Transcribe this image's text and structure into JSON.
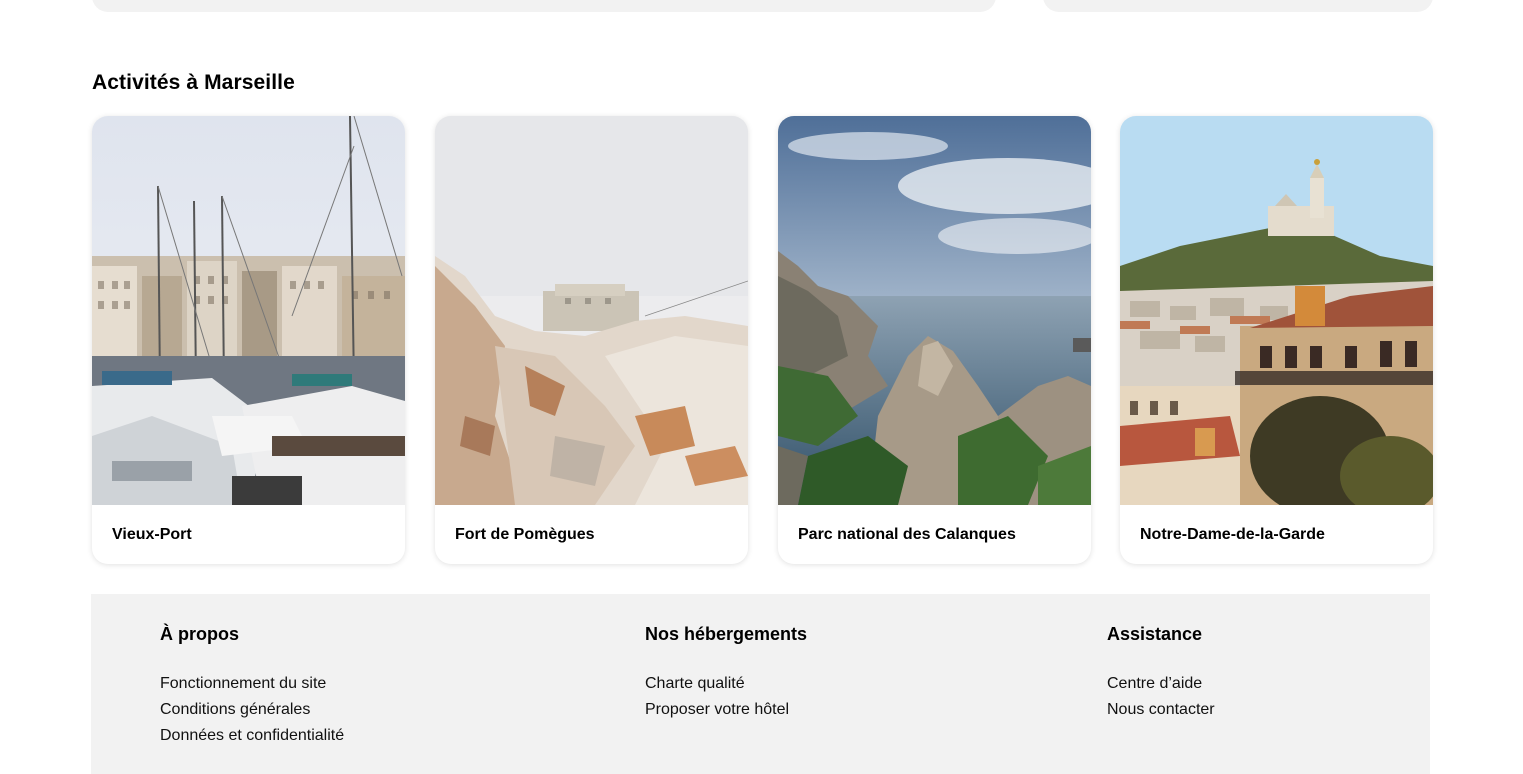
{
  "activities": {
    "title": "Activités à Marseille",
    "cards": [
      {
        "label": "Vieux-Port"
      },
      {
        "label": "Fort de Pomègues"
      },
      {
        "label": "Parc national des Calanques"
      },
      {
        "label": "Notre-Dame-de-la-Garde"
      }
    ]
  },
  "footer": {
    "columns": [
      {
        "heading": "À propos",
        "links": [
          "Fonctionnement du site",
          "Conditions générales",
          "Données et confidentialité"
        ]
      },
      {
        "heading": "Nos hébergements",
        "links": [
          "Charte qualité",
          "Proposer votre hôtel"
        ]
      },
      {
        "heading": "Assistance",
        "links": [
          "Centre d’aide",
          "Nous contacter"
        ]
      }
    ]
  }
}
